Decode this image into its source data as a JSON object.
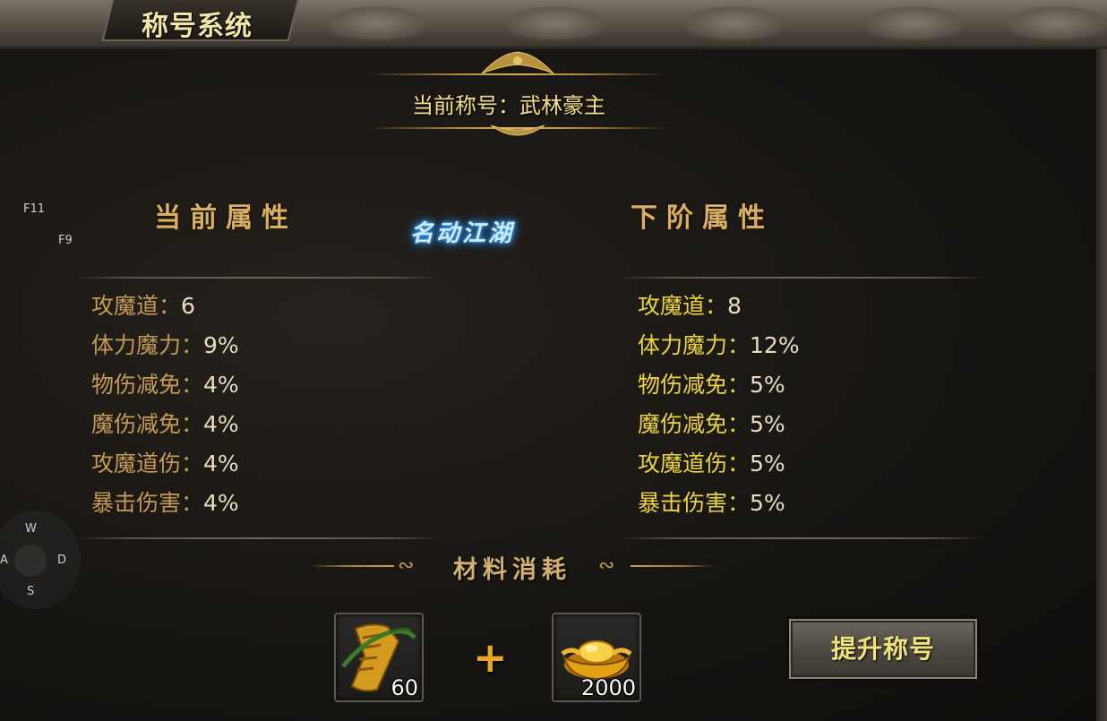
{
  "window": {
    "title": "称号系统"
  },
  "current_title": "当前称号：武林豪主",
  "rank_badge": "名动江湖",
  "headers": {
    "current": "当前属性",
    "next": "下阶属性"
  },
  "current_stats": [
    {
      "label": "攻魔道：",
      "value": "6"
    },
    {
      "label": "体力魔力：",
      "value": "9%"
    },
    {
      "label": "物伤减免：",
      "value": "4%"
    },
    {
      "label": "魔伤减免：",
      "value": "4%"
    },
    {
      "label": "攻魔道伤：",
      "value": "4%"
    },
    {
      "label": "暴击伤害：",
      "value": "4%"
    }
  ],
  "next_stats": [
    {
      "label": "攻魔道：",
      "value": "8"
    },
    {
      "label": "体力魔力：",
      "value": "12%"
    },
    {
      "label": "物伤减免：",
      "value": "5%"
    },
    {
      "label": "魔伤减免：",
      "value": "5%"
    },
    {
      "label": "攻魔道伤：",
      "value": "5%"
    },
    {
      "label": "暴击伤害：",
      "value": "5%"
    }
  ],
  "materials": {
    "title": "材料消耗",
    "plus": "+",
    "items": [
      {
        "icon": "scroll-icon",
        "count": "60"
      },
      {
        "icon": "gold-ingot-icon",
        "count": "2000"
      }
    ]
  },
  "upgrade_button": "提升称号",
  "hotkeys": {
    "f11": "F11",
    "f9": "F9"
  },
  "joystick": {
    "up": "W",
    "left": "A",
    "right": "D",
    "down": "S"
  },
  "colors": {
    "gold_text": "#f4e08a",
    "next_label": "#ecd53a",
    "current_label": "#c49a55",
    "badge_glow": "#2aa2ff"
  }
}
